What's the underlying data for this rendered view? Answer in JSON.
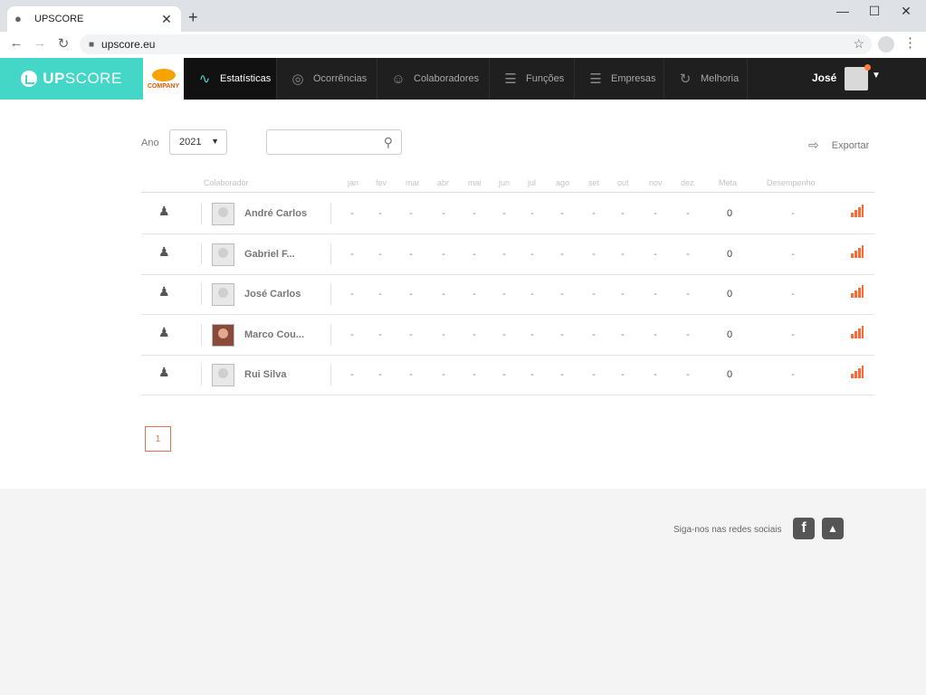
{
  "browser": {
    "tab_title": "UPSCORE",
    "url": "upscore.eu"
  },
  "nav": {
    "brand_a": "UP",
    "brand_b": "SCORE",
    "company": "COMPANY",
    "items": [
      {
        "label": "Estatísticas",
        "icon": "chart-line-icon"
      },
      {
        "label": "Ocorrências",
        "icon": "target-icon"
      },
      {
        "label": "Colaboradores",
        "icon": "users-icon"
      },
      {
        "label": "Funções",
        "icon": "list-icon"
      },
      {
        "label": "Empresas",
        "icon": "list-icon"
      },
      {
        "label": "Melhoria",
        "icon": "refresh-icon"
      }
    ],
    "user": "José"
  },
  "filters": {
    "year_label": "Ano",
    "year_value": "2021",
    "search_value": "",
    "export_label": "Exportar"
  },
  "table": {
    "headers": [
      "Colaborador",
      "jan",
      "fev",
      "mar",
      "abr",
      "mai",
      "jun",
      "jul",
      "ago",
      "set",
      "out",
      "nov",
      "dez",
      "Meta",
      "Desempenho"
    ],
    "rows": [
      {
        "name": "André Carlos",
        "months": [
          "-",
          "-",
          "-",
          "-",
          "-",
          "-",
          "-",
          "-",
          "-",
          "-",
          "-",
          "-"
        ],
        "meta": "0",
        "desempenho": "-"
      },
      {
        "name": "Gabriel F...",
        "months": [
          "-",
          "-",
          "-",
          "-",
          "-",
          "-",
          "-",
          "-",
          "-",
          "-",
          "-",
          "-"
        ],
        "meta": "0",
        "desempenho": "-"
      },
      {
        "name": "José Carlos",
        "months": [
          "-",
          "-",
          "-",
          "-",
          "-",
          "-",
          "-",
          "-",
          "-",
          "-",
          "-",
          "-"
        ],
        "meta": "0",
        "desempenho": "-"
      },
      {
        "name": "Marco Cou...",
        "months": [
          "-",
          "-",
          "-",
          "-",
          "-",
          "-",
          "-",
          "-",
          "-",
          "-",
          "-",
          "-"
        ],
        "meta": "0",
        "desempenho": "-"
      },
      {
        "name": "Rui Silva",
        "months": [
          "-",
          "-",
          "-",
          "-",
          "-",
          "-",
          "-",
          "-",
          "-",
          "-",
          "-",
          "-"
        ],
        "meta": "0",
        "desempenho": "-"
      }
    ]
  },
  "pagination": {
    "current": "1"
  },
  "footer": {
    "social_label": "Siga-nos nas redes sociais"
  },
  "colors": {
    "accent": "#44d7c7",
    "orange": "#ff6a33"
  }
}
